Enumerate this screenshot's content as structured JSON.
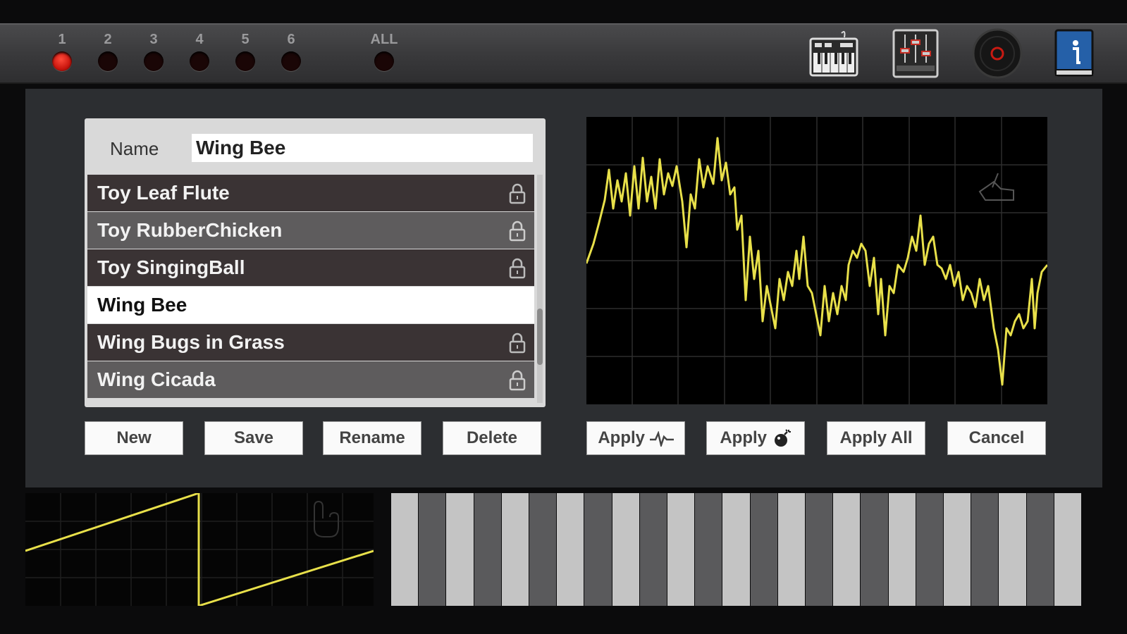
{
  "tracks": [
    {
      "label": "1",
      "active": true
    },
    {
      "label": "2",
      "active": false
    },
    {
      "label": "3",
      "active": false
    },
    {
      "label": "4",
      "active": false
    },
    {
      "label": "5",
      "active": false
    },
    {
      "label": "6",
      "active": false
    },
    {
      "label": "ALL",
      "active": false
    }
  ],
  "toolbar": {
    "icons": [
      "keyboard-icon",
      "mixer-icon",
      "record-icon",
      "info-book-icon"
    ]
  },
  "preset_editor": {
    "name_label": "Name",
    "name_value": "Wing Bee",
    "presets": [
      {
        "label": "Toy Leaf Flute",
        "locked": true
      },
      {
        "label": "Toy RubberChicken",
        "locked": true
      },
      {
        "label": "Toy SingingBall",
        "locked": true
      },
      {
        "label": "Wing Bee",
        "locked": false,
        "selected": true
      },
      {
        "label": "Wing Bugs in Grass",
        "locked": true
      },
      {
        "label": "Wing Cicada",
        "locked": true
      }
    ],
    "buttons": {
      "new": "New",
      "save": "Save",
      "rename": "Rename",
      "delete": "Delete"
    }
  },
  "waveform_panel": {
    "buttons": {
      "apply_wave": "Apply",
      "apply_fx": "Apply",
      "apply_all": "Apply All",
      "cancel": "Cancel"
    },
    "trace_color": "#e8e04a"
  },
  "colors": {
    "accent": "#e8e04a",
    "led_on": "#d81e12",
    "panel": "#2c2e31"
  }
}
